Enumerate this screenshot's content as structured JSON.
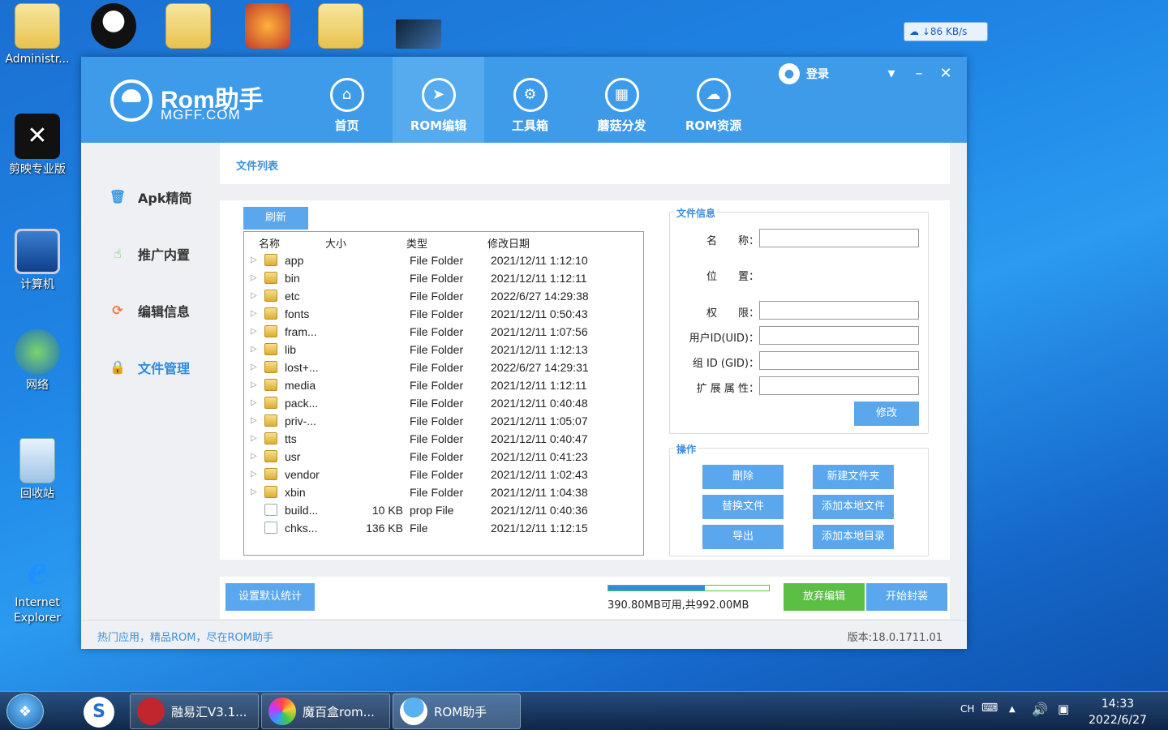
{
  "desktop": {
    "icons": [
      {
        "label": "Administr..."
      },
      {
        "label": "剪映专业版"
      },
      {
        "label": "计算机"
      },
      {
        "label": "网络"
      },
      {
        "label": "回收站"
      },
      {
        "label": "Internet Explorer"
      }
    ],
    "net_speed": "↓86 KB/s"
  },
  "app": {
    "brand": "Rom助手",
    "brand_sub": "MGFF.COM",
    "nav": [
      {
        "label": "首页",
        "icon": "home-icon"
      },
      {
        "label": "ROM编辑",
        "icon": "cursor-icon"
      },
      {
        "label": "工具箱",
        "icon": "gear-icon"
      },
      {
        "label": "蘑菇分发",
        "icon": "grid-icon"
      },
      {
        "label": "ROM资源",
        "icon": "cloud-icon"
      }
    ],
    "login": "登录",
    "sidebar": [
      {
        "label": "Apk精简",
        "icon": "trash-icon"
      },
      {
        "label": "推广内置",
        "icon": "pointer-icon"
      },
      {
        "label": "编辑信息",
        "icon": "refresh-icon"
      },
      {
        "label": "文件管理",
        "icon": "lock-icon"
      }
    ],
    "panel_title": "文件列表",
    "refresh_button": "刷新",
    "columns": [
      "名称",
      "大小",
      "类型",
      "修改日期"
    ],
    "files": [
      {
        "name": "app",
        "size": "",
        "type": "File Folder",
        "date": "2021/12/11 1:12:10",
        "kind": "folder"
      },
      {
        "name": "bin",
        "size": "",
        "type": "File Folder",
        "date": "2021/12/11 1:12:11",
        "kind": "folder"
      },
      {
        "name": "etc",
        "size": "",
        "type": "File Folder",
        "date": "2022/6/27 14:29:38",
        "kind": "folder"
      },
      {
        "name": "fonts",
        "size": "",
        "type": "File Folder",
        "date": "2021/12/11 0:50:43",
        "kind": "folder"
      },
      {
        "name": "fram...",
        "size": "",
        "type": "File Folder",
        "date": "2021/12/11 1:07:56",
        "kind": "folder"
      },
      {
        "name": "lib",
        "size": "",
        "type": "File Folder",
        "date": "2021/12/11 1:12:13",
        "kind": "folder"
      },
      {
        "name": "lost+...",
        "size": "",
        "type": "File Folder",
        "date": "2022/6/27 14:29:31",
        "kind": "folder"
      },
      {
        "name": "media",
        "size": "",
        "type": "File Folder",
        "date": "2021/12/11 1:12:11",
        "kind": "folder"
      },
      {
        "name": "pack...",
        "size": "",
        "type": "File Folder",
        "date": "2021/12/11 0:40:48",
        "kind": "folder"
      },
      {
        "name": "priv-...",
        "size": "",
        "type": "File Folder",
        "date": "2021/12/11 1:05:07",
        "kind": "folder"
      },
      {
        "name": "tts",
        "size": "",
        "type": "File Folder",
        "date": "2021/12/11 0:40:47",
        "kind": "folder"
      },
      {
        "name": "usr",
        "size": "",
        "type": "File Folder",
        "date": "2021/12/11 0:41:23",
        "kind": "folder"
      },
      {
        "name": "vendor",
        "size": "",
        "type": "File Folder",
        "date": "2021/12/11 1:02:43",
        "kind": "folder"
      },
      {
        "name": "xbin",
        "size": "",
        "type": "File Folder",
        "date": "2021/12/11 1:04:38",
        "kind": "folder"
      },
      {
        "name": "build...",
        "size": "10 KB",
        "type": "prop File",
        "date": "2021/12/11 0:40:36",
        "kind": "file"
      },
      {
        "name": "chks...",
        "size": "136 KB",
        "type": "File",
        "date": "2021/12/11 1:12:15",
        "kind": "file"
      }
    ],
    "file_info": {
      "title": "文件信息",
      "name_label": "名　　称：",
      "location_label": "位　　置：",
      "perm_label": "权　　限：",
      "uid_label": "用户ID(UID)：",
      "gid_label": "组 ID (GID)：",
      "ext_label": "扩 展 属 性：",
      "modify_button": "修改"
    },
    "ops": {
      "title": "操作",
      "delete": "删除",
      "new_folder": "新建文件夹",
      "replace": "替换文件",
      "add_local_file": "添加本地文件",
      "export": "导出",
      "add_local_dir": "添加本地目录"
    },
    "set_default_stats": "设置默认统计",
    "storage_text": "390.80MB可用,共992.00MB",
    "storage_used_fraction": 0.6,
    "discard_button": "放弃编辑",
    "package_button": "开始封装",
    "footer_slogan": "热门应用，精品ROM，尽在ROM助手",
    "version": "版本:18.0.1711.01"
  },
  "taskbar": {
    "items": [
      {
        "label": "融易汇V3.1..."
      },
      {
        "label": "魔百盒rom..."
      },
      {
        "label": "ROM助手"
      }
    ],
    "lang": "CH",
    "time": "14:33",
    "date": "2022/6/27"
  }
}
